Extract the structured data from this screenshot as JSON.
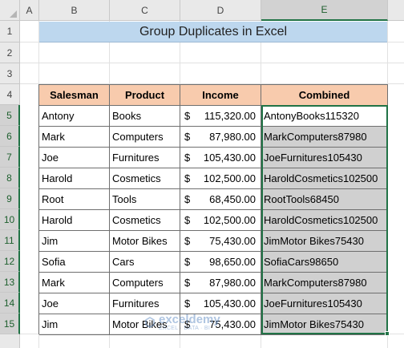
{
  "columns": [
    "A",
    "B",
    "C",
    "D",
    "E"
  ],
  "rows": [
    "1",
    "2",
    "3",
    "4",
    "5",
    "6",
    "7",
    "8",
    "9",
    "10",
    "11",
    "12",
    "13",
    "14",
    "15"
  ],
  "title": "Group Duplicates in Excel",
  "table": {
    "headers": [
      "Salesman",
      "Product",
      "Income",
      "Combined"
    ],
    "currency_symbol": "$",
    "rows": [
      {
        "salesman": "Antony",
        "product": "Books",
        "income": "115,320.00",
        "combined": "AntonyBooks115320"
      },
      {
        "salesman": "Mark",
        "product": "Computers",
        "income": "87,980.00",
        "combined": "MarkComputers87980"
      },
      {
        "salesman": "Joe",
        "product": "Furnitures",
        "income": "105,430.00",
        "combined": "JoeFurnitures105430"
      },
      {
        "salesman": "Harold",
        "product": "Cosmetics",
        "income": "102,500.00",
        "combined": "HaroldCosmetics102500"
      },
      {
        "salesman": "Root",
        "product": "Tools",
        "income": "68,450.00",
        "combined": "RootTools68450"
      },
      {
        "salesman": "Harold",
        "product": "Cosmetics",
        "income": "102,500.00",
        "combined": "HaroldCosmetics102500"
      },
      {
        "salesman": "Jim",
        "product": "Motor Bikes",
        "income": "75,430.00",
        "combined": "JimMotor Bikes75430"
      },
      {
        "salesman": "Sofia",
        "product": "Cars",
        "income": "98,650.00",
        "combined": "SofiaCars98650"
      },
      {
        "salesman": "Mark",
        "product": "Computers",
        "income": "87,980.00",
        "combined": "MarkComputers87980"
      },
      {
        "salesman": "Joe",
        "product": "Furnitures",
        "income": "105,430.00",
        "combined": "JoeFurnitures105430"
      },
      {
        "salesman": "Jim",
        "product": "Motor Bikes",
        "income": "75,430.00",
        "combined": "JimMotor Bikes75430"
      }
    ]
  },
  "watermark": {
    "name": "exceldemy",
    "tagline": "EXCEL · DATA · BI"
  },
  "colors": {
    "title_fill": "#bdd7ee",
    "header_fill": "#f8cbad",
    "selection": "#217346",
    "selected_fill": "#d0d0d0"
  }
}
